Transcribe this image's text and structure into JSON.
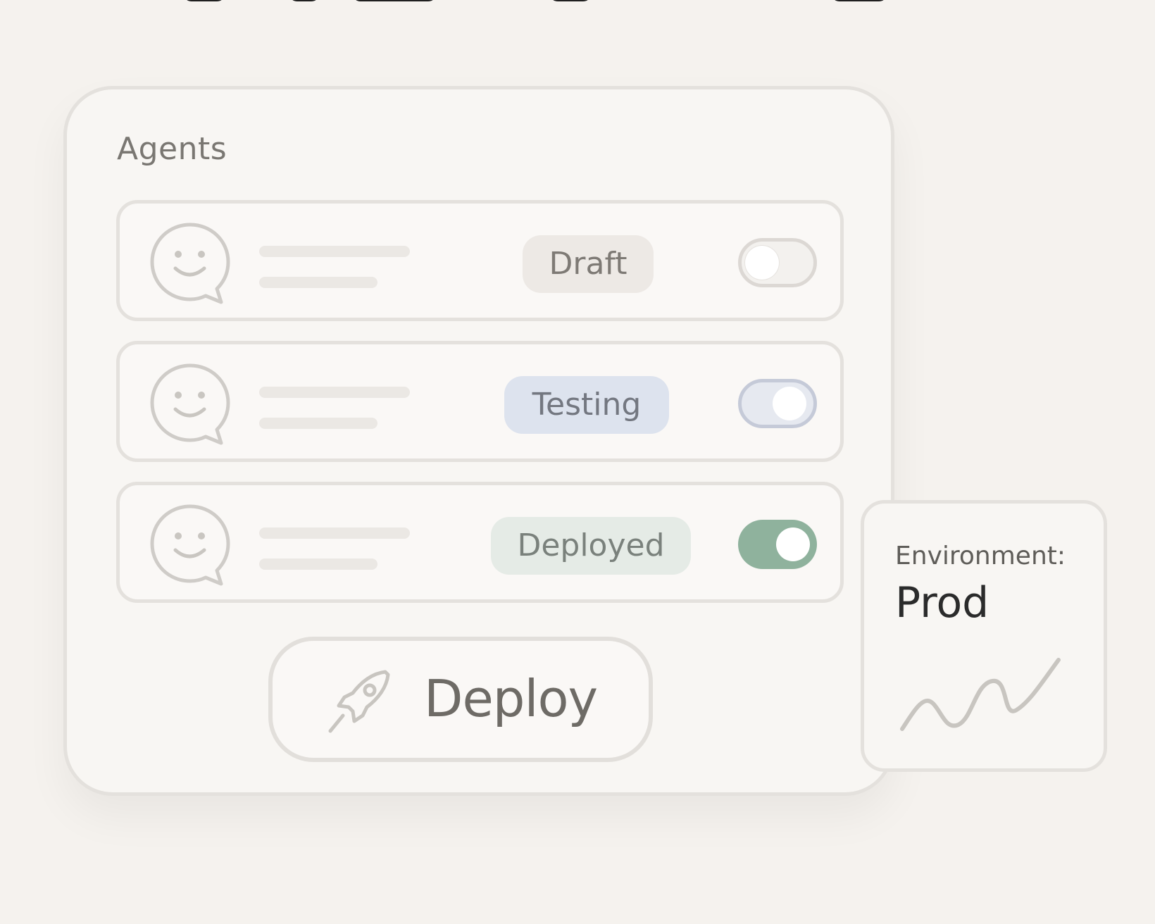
{
  "panel": {
    "title": "Agents"
  },
  "agents": [
    {
      "status": "Draft",
      "toggle_on": false,
      "status_color": "#ede9e5"
    },
    {
      "status": "Testing",
      "toggle_on": false,
      "status_color": "#dde3ee"
    },
    {
      "status": "Deployed",
      "toggle_on": true,
      "status_color": "#e5ebe6"
    }
  ],
  "actions": {
    "deploy_label": "Deploy",
    "deploy_icon": "rocket-icon"
  },
  "environment": {
    "label": "Environment:",
    "value": "Prod",
    "icon": "sparkline-icon"
  },
  "colors": {
    "background": "#f5f2ee",
    "accent_green": "#8fb29d",
    "accent_blue": "#c5cad8"
  }
}
